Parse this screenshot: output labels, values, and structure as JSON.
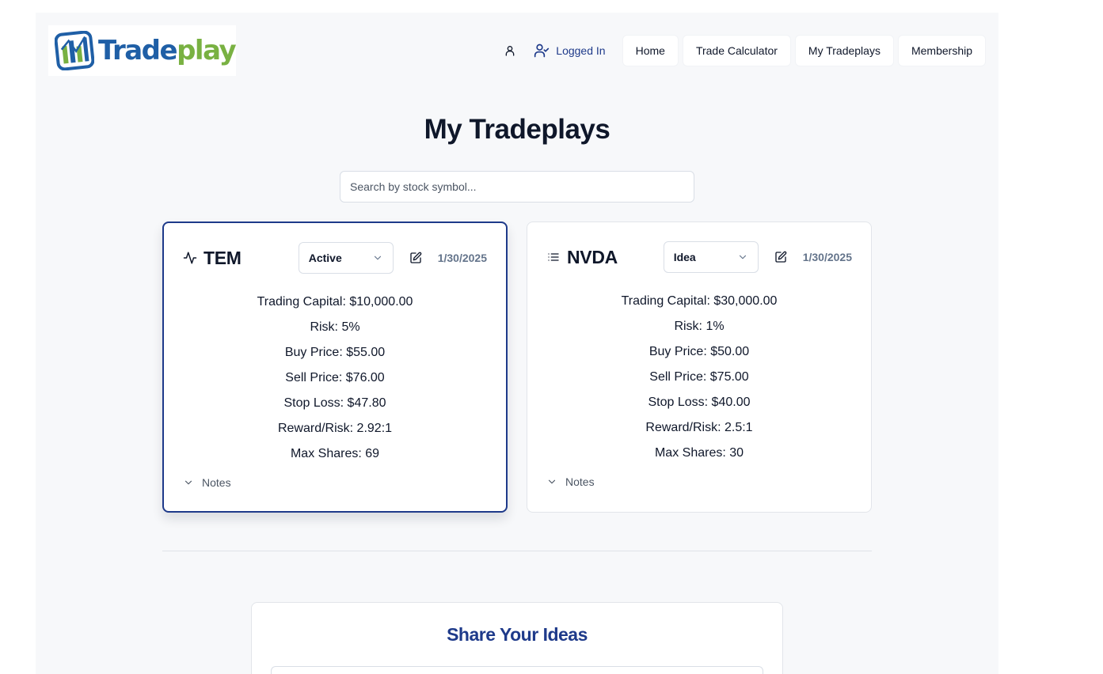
{
  "header": {
    "logo": {
      "text_primary": "Trade",
      "text_secondary": "play"
    },
    "nav": {
      "logged_in_label": "Logged In",
      "items": [
        "Home",
        "Trade Calculator",
        "My Tradeplays",
        "Membership"
      ]
    }
  },
  "main": {
    "title": "My Tradeplays",
    "search": {
      "placeholder": "Search by stock symbol...",
      "value": ""
    },
    "cards": [
      {
        "symbol": "TEM",
        "icon": "activity-icon",
        "status": "Active",
        "date": "1/30/2025",
        "stats": [
          "Trading Capital: $10,000.00",
          "Risk: 5%",
          "Buy Price: $55.00",
          "Sell Price: $76.00",
          "Stop Loss: $47.80",
          "Reward/Risk: 2.92:1",
          "Max Shares: 69"
        ],
        "notes_label": "Notes",
        "selected": true
      },
      {
        "symbol": "NVDA",
        "icon": "list-icon",
        "status": "Idea",
        "date": "1/30/2025",
        "stats": [
          "Trading Capital: $30,000.00",
          "Risk: 1%",
          "Buy Price: $50.00",
          "Sell Price: $75.00",
          "Stop Loss: $40.00",
          "Reward/Risk: 2.5:1",
          "Max Shares: 30"
        ],
        "notes_label": "Notes",
        "selected": false
      }
    ]
  },
  "share": {
    "title": "Share Your Ideas"
  },
  "colors": {
    "accent": "#1e3a8a",
    "logo_blue": "#1f5fa6",
    "logo_green": "#79b142",
    "background": "#f7f8fa"
  }
}
